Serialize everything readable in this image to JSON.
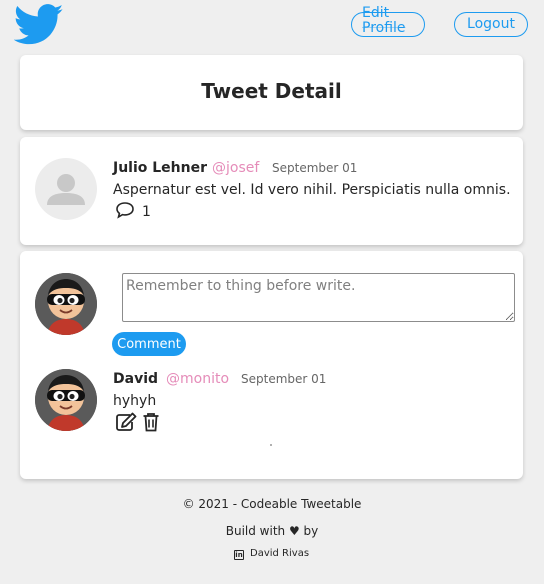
{
  "header": {
    "logo_icon": "twitter-bird-icon",
    "edit_profile_label": "Edit Profile",
    "logout_label": "Logout",
    "accent_color": "#1d9bf0"
  },
  "title_card": {
    "title": "Tweet Detail"
  },
  "tweet": {
    "author_name": "Julio Lehner",
    "author_handle": "@josef",
    "date": "September 01",
    "text": "Aspernatur est vel. Id vero nihil. Perspiciatis nulla omnis.",
    "comment_icon": "speech-bubble-icon",
    "comment_count": "1"
  },
  "composer": {
    "placeholder": "Remember to thing before write.",
    "value": "",
    "button_label": "Comment"
  },
  "comments": [
    {
      "author_name": "David",
      "author_handle": "@monito",
      "date": "September 01",
      "text": "hyhyh",
      "edit_icon": "edit-icon",
      "delete_icon": "trash-icon"
    }
  ],
  "footer": {
    "copyright": "© 2021 - Codeable Tweetable",
    "build_with": "Build with ♥ by",
    "author_icon": "linkedin-icon",
    "author_name": "David Rivas"
  }
}
